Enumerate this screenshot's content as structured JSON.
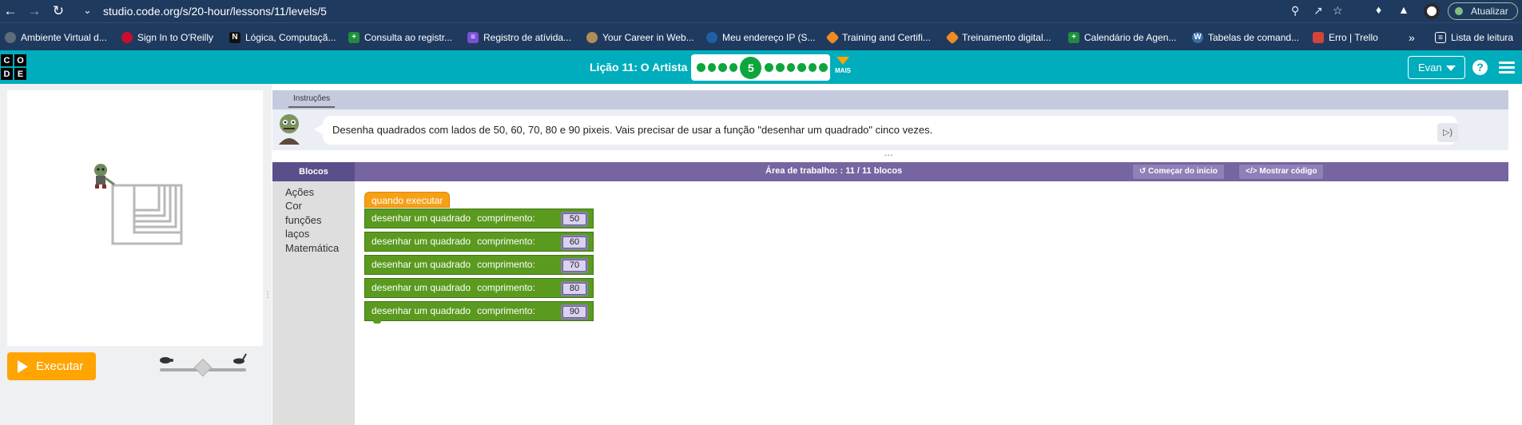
{
  "browser": {
    "url": "studio.code.org/s/20-hour/lessons/11/levels/5",
    "update_label": "Atualizar",
    "bookmarks": [
      {
        "label": "Ambiente Virtual d...",
        "color": "#5f6b7a"
      },
      {
        "label": "Sign In to O'Reilly",
        "color": "#c8102e"
      },
      {
        "label": "Lógica, Computaçã...",
        "color": "#111111"
      },
      {
        "label": "Consulta ao registr...",
        "color": "#1e8e3e"
      },
      {
        "label": "Registro de atívida...",
        "color": "#7b4fd6"
      },
      {
        "label": "Your Career in Web...",
        "color": "#b08d57"
      },
      {
        "label": "Meu endereço IP (S...",
        "color": "#1f5fa8"
      },
      {
        "label": "Training and Certifi...",
        "color": "#f08a24"
      },
      {
        "label": "Treinamento digital...",
        "color": "#f08a24"
      },
      {
        "label": "Calendário de Agen...",
        "color": "#1e8e3e"
      },
      {
        "label": "Tabelas de comand...",
        "color": "#3a6ea5"
      },
      {
        "label": "Erro | Trello",
        "color": "#d1453b"
      }
    ],
    "more_bookmarks": "»",
    "reading_list": "Lista de leitura"
  },
  "header": {
    "logo_letters": [
      "C",
      "O",
      "D",
      "E"
    ],
    "lesson_title": "Lição 11: O Artista 3",
    "current_level": "5",
    "dots_before": 4,
    "dots_after": 6,
    "more_label": "MAIS",
    "user_name": "Evan",
    "help_glyph": "?"
  },
  "instructions": {
    "tab_label": "Instruções",
    "text": "Desenha quadrados com lados de 50, 60, 70, 80 e 90 pixeis. Vais precisar de usar a função \"desenhar um quadrado\" cinco vezes."
  },
  "controls": {
    "run_label": "Executar",
    "speed": 0.5
  },
  "workspace": {
    "toolbox_title": "Blocos",
    "title": "Área de trabalho: : 11 / 11 blocos",
    "restart_label": "Começar do início",
    "show_code_label": "Mostrar código",
    "categories": [
      "Ações",
      "Cor",
      "funções",
      "laços",
      "Matemática"
    ],
    "hat_label": "quando executar",
    "block_label": "desenhar um quadrado",
    "length_label": "comprimento:",
    "lengths": [
      "50",
      "60",
      "70",
      "80",
      "90"
    ]
  },
  "colors": {
    "brand": "#00adbc",
    "run_button": "#ffa400",
    "block_green": "#5a9a1f",
    "hat_orange": "#f6a016",
    "workspace_header": "#7665a0"
  }
}
